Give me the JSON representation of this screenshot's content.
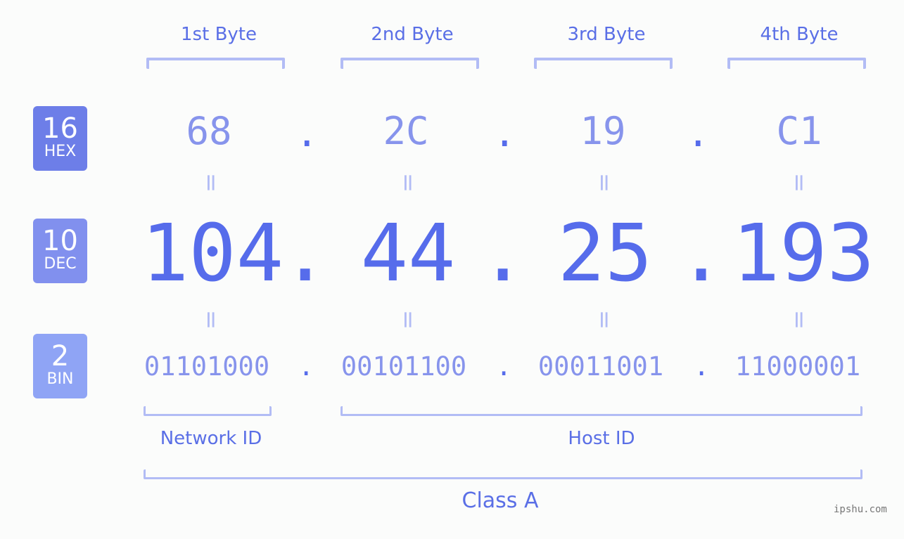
{
  "headers": [
    "1st Byte",
    "2nd Byte",
    "3rd Byte",
    "4th Byte"
  ],
  "bases": [
    {
      "num": "16",
      "label": "HEX",
      "color": "#6d7ee8"
    },
    {
      "num": "10",
      "label": "DEC",
      "color": "#8190ee"
    },
    {
      "num": "2",
      "label": "BIN",
      "color": "#8fa4f5"
    }
  ],
  "hex": [
    "68",
    "2C",
    "19",
    "C1"
  ],
  "dec": [
    "104",
    "44",
    "25",
    "193"
  ],
  "bin": [
    "01101000",
    "00101100",
    "00011001",
    "11000001"
  ],
  "separator": ".",
  "equals": "=",
  "network_label": "Network ID",
  "host_label": "Host ID",
  "class_label": "Class A",
  "watermark": "ipshu.com"
}
